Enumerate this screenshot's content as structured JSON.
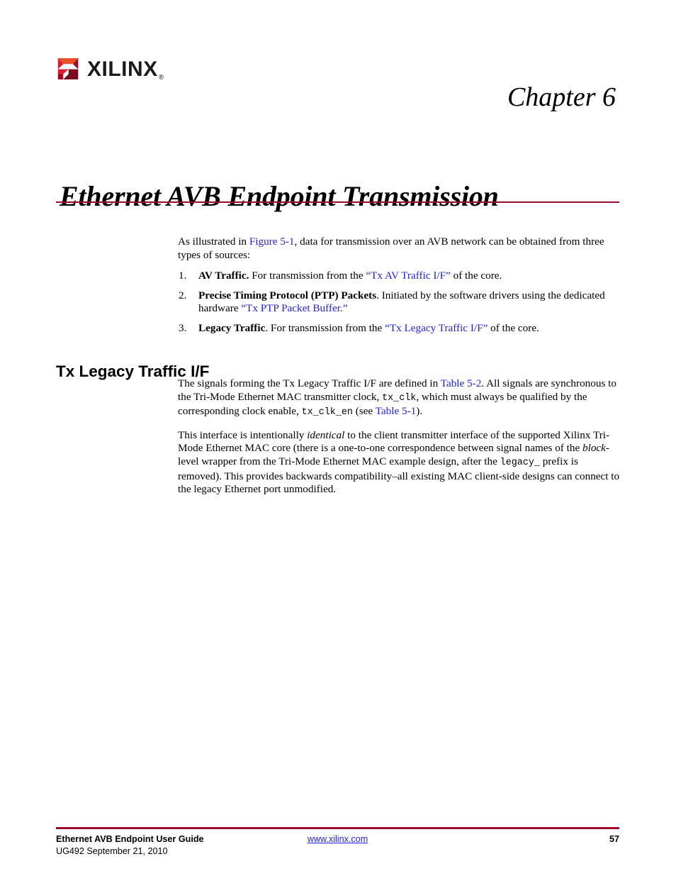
{
  "logo": {
    "wordmark": "XILINX",
    "registered": "®",
    "colors": {
      "orange": "#e8512a",
      "red": "#d81f32",
      "maroon": "#9e0b28",
      "dark": "#7d0b20"
    }
  },
  "header": {
    "chapter_label": "Chapter 6"
  },
  "title": {
    "text": "Ethernet AVB Endpoint Transmission",
    "rule_color": "#9e0b28"
  },
  "intro": {
    "line_a": "As illustrated in ",
    "xref_figure": "Figure 5-1",
    "line_b": ", data for transmission over an AVB network can be obtained from three types of sources:"
  },
  "list": [
    {
      "number": "1.",
      "lead": "AV Traffic.",
      "text_before": " For transmission from the ",
      "link": "“Tx AV Traffic I/F”",
      "text_after": " of the core."
    },
    {
      "number": "2.",
      "lead": "Precise Timing Protocol (PTP) Packets",
      "text_before": ". Initiated by the software drivers using the dedicated hardware ",
      "link": "“Tx PTP Packet Buffer.”",
      "text_after": ""
    },
    {
      "number": "3.",
      "lead": "Legacy Traffic",
      "text_before": ". For transmission from the ",
      "link": "“Tx Legacy Traffic I/F”",
      "text_after": " of the core."
    }
  ],
  "section": {
    "heading": "Tx Legacy Traffic I/F",
    "para1": {
      "s1": "The signals forming the Tx Legacy Traffic I/F are defined in ",
      "xref1": "Table 5-2",
      "s2": ". All signals are synchronous to the Tri-Mode Ethernet MAC transmitter clock, ",
      "code1": "tx_clk",
      "s3": ", which must always be qualified by the corresponding clock enable, ",
      "code2": "tx_clk_en",
      "s4": " (see ",
      "xref2": "Table 5-1",
      "s5": ")."
    },
    "para2": {
      "s1": "This interface is intentionally ",
      "em1": "identical",
      "s2": " to the client transmitter interface of the supported Xilinx Tri-Mode Ethernet MAC core (there is a one-to-one correspondence between signal names of the ",
      "em2": "block",
      "s3": "-level wrapper from the Tri-Mode Ethernet MAC example design, after the ",
      "code1": "legacy_",
      "s4": " prefix is removed). This provides backwards compatibility–all existing MAC client-side designs can connect to the legacy Ethernet port unmodified."
    }
  },
  "footer": {
    "rule_color": "#9e0b28",
    "doc_title": "Ethernet AVB Endpoint User Guide",
    "doc_id_date": "UG492 September 21, 2010",
    "url": "www.xilinx.com",
    "page_number": "57"
  }
}
